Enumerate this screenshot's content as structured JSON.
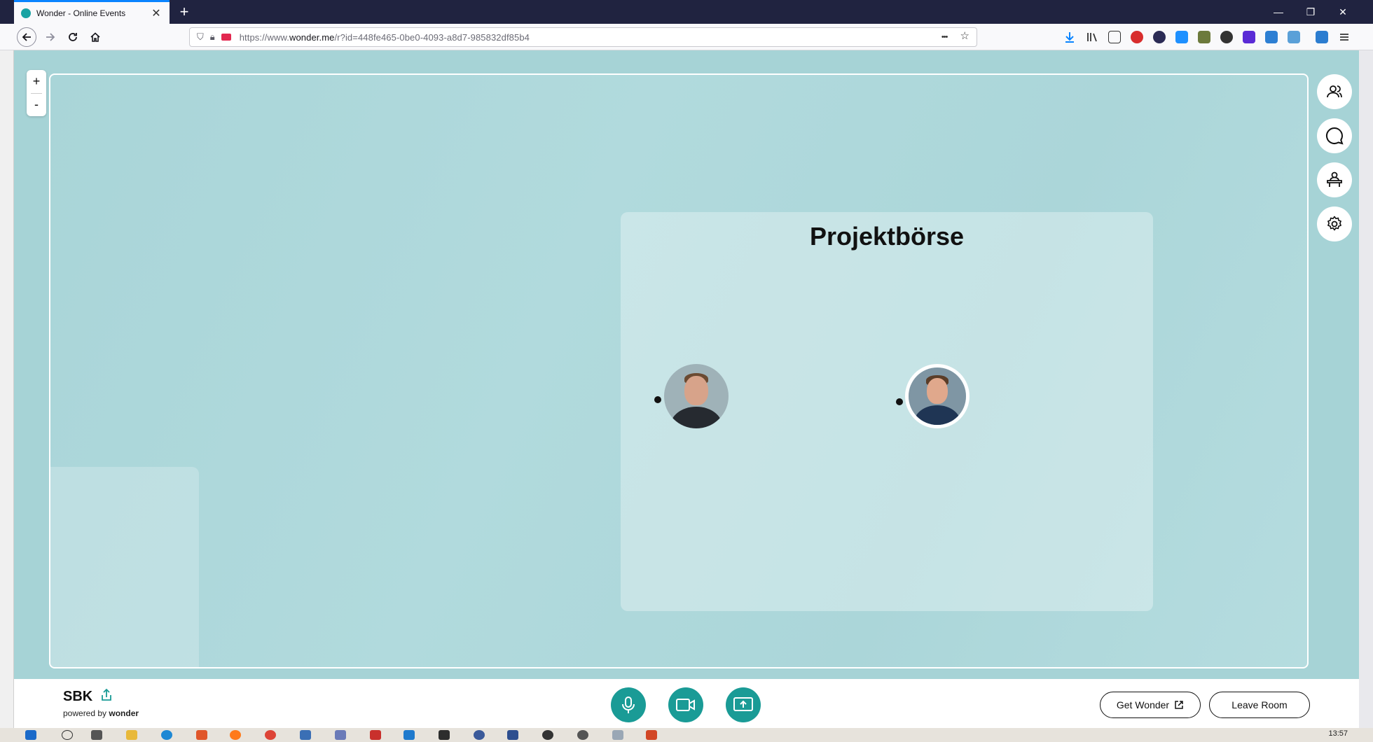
{
  "browser": {
    "tab_title": "Wonder - Online Events",
    "tab_close": "✕",
    "new_tab": "+",
    "url_prefix": "https://www.",
    "url_domain": "wonder.me",
    "url_path": "/r?id=448fe465-0be0-4093-a8d7-985832df85b4",
    "more_glyph": "•••",
    "bookmark_glyph": "☆"
  },
  "window_controls": {
    "minimize": "—",
    "restore": "❐",
    "close": "✕"
  },
  "zoom": {
    "in": "+",
    "out": "-"
  },
  "room": {
    "title": "Projektbörse"
  },
  "space": {
    "name": "SBK",
    "powered_prefix": "powered by",
    "powered_brand": "wonder"
  },
  "actions": {
    "get_wonder": "Get Wonder",
    "leave_room": "Leave Room"
  },
  "taskbar": {
    "clock": "13:57"
  },
  "colors": {
    "accent": "#1a9b96",
    "canvas": "#a9d5d8"
  }
}
